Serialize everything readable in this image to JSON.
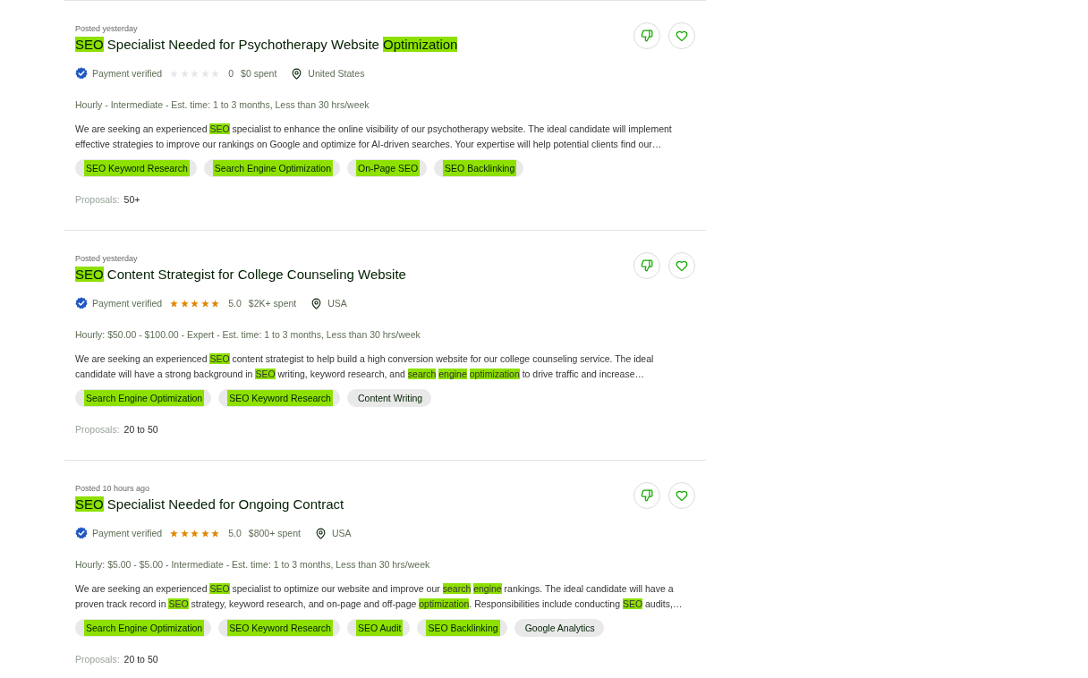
{
  "jobs": [
    {
      "posted": "Posted yesterday",
      "title": [
        {
          "text": "SEO",
          "highlighted": true
        },
        {
          "text": " Specialist Needed for Psychotherapy Website ",
          "highlighted": false
        },
        {
          "text": "Optimization",
          "highlighted": true
        }
      ],
      "client": {
        "payment": "Payment verified",
        "stars": 0,
        "rating": "0",
        "spent": "$0 spent",
        "location": "United States"
      },
      "terms": "Hourly - Intermediate - Est. time: 1 to 3 months, Less than 30 hrs/week",
      "description_lines": [
        [
          {
            "text": "We are seeking an experienced ",
            "highlighted": false
          },
          {
            "text": "SEO",
            "highlighted": true
          },
          {
            "text": " specialist to enhance the online visibility of our psychotherapy website. The ideal candidate will implement",
            "highlighted": false
          }
        ],
        [
          {
            "text": "effective strategies to improve our rankings on Google and optimize for AI-driven searches. Your expertise will help potential clients find our…",
            "highlighted": false
          }
        ]
      ],
      "skills": [
        {
          "label": "SEO Keyword Research",
          "highlighted": true
        },
        {
          "label": "Search Engine Optimization",
          "highlighted": true
        },
        {
          "label": "On-Page SEO",
          "highlighted": true
        },
        {
          "label": "SEO Backlinking",
          "highlighted": true
        }
      ],
      "proposals_label": "Proposals:",
      "proposals": "50+"
    },
    {
      "posted": "Posted yesterday",
      "title": [
        {
          "text": "SEO",
          "highlighted": true
        },
        {
          "text": " Content Strategist for College Counseling Website",
          "highlighted": false
        }
      ],
      "client": {
        "payment": "Payment verified",
        "stars": 5,
        "rating": "5.0",
        "spent": "$2K+ spent",
        "location": "USA"
      },
      "terms": "Hourly: $50.00 - $100.00 - Expert - Est. time: 1 to 3 months, Less than 30 hrs/week",
      "description_lines": [
        [
          {
            "text": "We are seeking an experienced ",
            "highlighted": false
          },
          {
            "text": "SEO",
            "highlighted": true
          },
          {
            "text": " content strategist to help build a high conversion website for our college counseling service. The ideal",
            "highlighted": false
          }
        ],
        [
          {
            "text": "candidate will have a strong background in ",
            "highlighted": false
          },
          {
            "text": "SEO",
            "highlighted": true
          },
          {
            "text": " writing, keyword research, and ",
            "highlighted": false
          },
          {
            "text": "search engine optimization",
            "highlighted": true
          },
          {
            "text": " to drive traffic and increase…",
            "highlighted": false
          }
        ]
      ],
      "skills": [
        {
          "label": "Search Engine Optimization",
          "highlighted": true
        },
        {
          "label": "SEO Keyword Research",
          "highlighted": true
        },
        {
          "label": "Content Writing",
          "highlighted": false
        }
      ],
      "proposals_label": "Proposals:",
      "proposals": "20 to 50"
    },
    {
      "posted": "Posted 10 hours ago",
      "title": [
        {
          "text": "SEO",
          "highlighted": true
        },
        {
          "text": " Specialist Needed for Ongoing Contract",
          "highlighted": false
        }
      ],
      "client": {
        "payment": "Payment verified",
        "stars": 5,
        "rating": "5.0",
        "spent": "$800+ spent",
        "location": "USA"
      },
      "terms": "Hourly: $5.00 - $5.00 - Intermediate - Est. time: 1 to 3 months, Less than 30 hrs/week",
      "description_lines": [
        [
          {
            "text": "We are seeking an experienced ",
            "highlighted": false
          },
          {
            "text": "SEO",
            "highlighted": true
          },
          {
            "text": " specialist to optimize our website and improve our ",
            "highlighted": false
          },
          {
            "text": "search engine",
            "highlighted": true
          },
          {
            "text": " rankings. The ideal candidate will have a",
            "highlighted": false
          }
        ],
        [
          {
            "text": "proven track record in ",
            "highlighted": false
          },
          {
            "text": "SEO",
            "highlighted": true
          },
          {
            "text": " strategy, keyword research, and on-page and off-page ",
            "highlighted": false
          },
          {
            "text": "optimization",
            "highlighted": true
          },
          {
            "text": ". Responsibilities include conducting ",
            "highlighted": false
          },
          {
            "text": "SEO",
            "highlighted": true
          },
          {
            "text": " audits,…",
            "highlighted": false
          }
        ]
      ],
      "skills": [
        {
          "label": "Search Engine Optimization",
          "highlighted": true
        },
        {
          "label": "SEO Keyword Research",
          "highlighted": true
        },
        {
          "label": "SEO Audit",
          "highlighted": true
        },
        {
          "label": "SEO Backlinking",
          "highlighted": true
        },
        {
          "label": "Google Analytics",
          "highlighted": false
        }
      ],
      "proposals_label": "Proposals:",
      "proposals": "20 to 50"
    }
  ]
}
